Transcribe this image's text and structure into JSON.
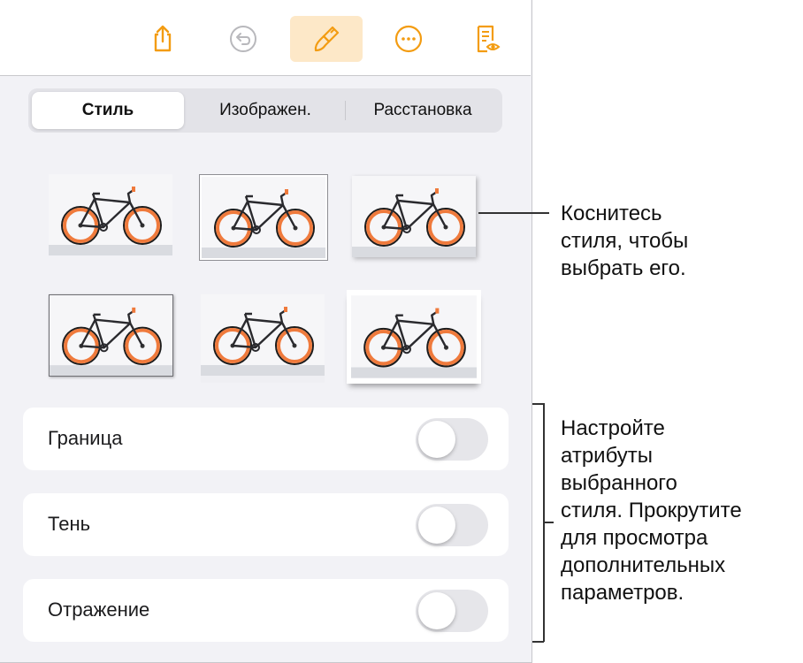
{
  "toolbar": {
    "buttons": [
      {
        "icon": "share-icon"
      },
      {
        "icon": "undo-icon"
      },
      {
        "icon": "format-brush-icon",
        "active": true
      },
      {
        "icon": "more-icon"
      },
      {
        "icon": "reading-view-icon"
      }
    ],
    "accent": "#f39c12"
  },
  "tabs": {
    "style": "Стиль",
    "image": "Изображен.",
    "arrange": "Расстановка",
    "selected": "style"
  },
  "styles": [
    {
      "name": "plain"
    },
    {
      "name": "thin-border",
      "selected": true
    },
    {
      "name": "soft-shadow"
    },
    {
      "name": "framed"
    },
    {
      "name": "reflection"
    },
    {
      "name": "curl-shadow"
    }
  ],
  "options": {
    "border": {
      "label": "Граница",
      "on": false
    },
    "shadow": {
      "label": "Тень",
      "on": false
    },
    "reflection": {
      "label": "Отражение",
      "on": false
    }
  },
  "callouts": {
    "tap_style": [
      "Коснитесь",
      "стиля, чтобы",
      "выбрать его."
    ],
    "adjust": [
      "Настройте",
      "атрибуты",
      "выбранного",
      "стиля. Прокрутите",
      "для просмотра",
      "дополнительных",
      "параметров."
    ]
  }
}
